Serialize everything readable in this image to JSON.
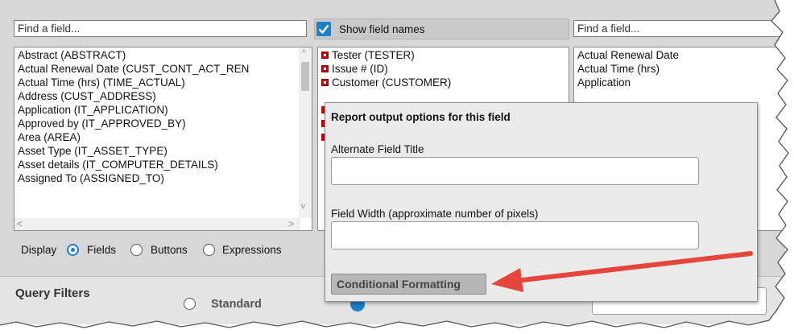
{
  "top": {
    "left_search_placeholder": "Find a field...",
    "show_field_names_label": "Show field names",
    "show_field_names_checked": true,
    "right_search_placeholder": "Find a field..."
  },
  "available_fields": [
    "Abstract (ABSTRACT)",
    "Actual Renewal Date (CUST_CONT_ACT_REN",
    "Actual Time (hrs) (TIME_ACTUAL)",
    "Address (CUST_ADDRESS)",
    "Application (IT_APPLICATION)",
    "Approved by (IT_APPROVED_BY)",
    "Area (AREA)",
    "Asset Type (IT_ASSET_TYPE)",
    "Asset details (IT_COMPUTER_DETAILS)",
    "Assigned To (ASSIGNED_TO)"
  ],
  "selected_fields": [
    "Tester (TESTER)",
    "Issue # (ID)",
    "Customer (CUSTOMER)"
  ],
  "right_fields": [
    "Actual Renewal Date",
    "Actual Time (hrs)",
    "Application"
  ],
  "display": {
    "label": "Display",
    "options": [
      "Fields",
      "Buttons",
      "Expressions"
    ],
    "selected": "Fields"
  },
  "query_filters": {
    "heading": "Query Filters",
    "standard_label": "Standard"
  },
  "popup": {
    "title": "Report output options for this field",
    "alt_title_label": "Alternate Field Title",
    "alt_title_value": "",
    "width_label": "Field Width (approximate number of pixels)",
    "width_value": "",
    "conditional_formatting_label": "Conditional Formatting"
  },
  "colors": {
    "arrow": "#e5453b",
    "checkbox": "#1e7ec8",
    "field_marker": "#d40000"
  }
}
